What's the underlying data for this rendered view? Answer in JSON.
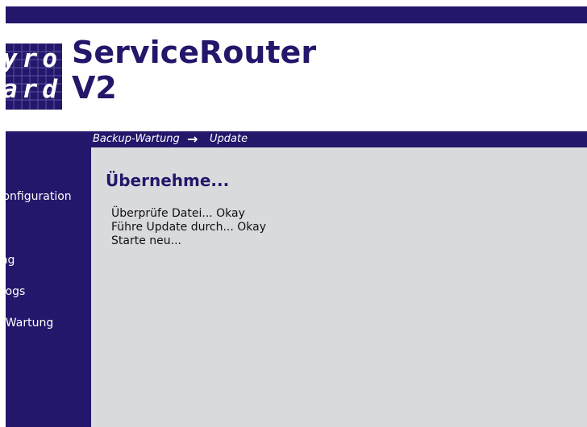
{
  "header": {
    "logo_line1": "yro",
    "logo_line2": "ard",
    "title_line1": "ServiceRouter",
    "title_line2": "V2"
  },
  "sidebar": {
    "items": [
      {
        "label": "Konfiguration"
      },
      {
        "label": "Wartung"
      },
      {
        "label": "Logs"
      },
      {
        "label": "Backup-Wartung"
      }
    ]
  },
  "breadcrumb": {
    "parent": "Backup-Wartung",
    "separator": "→",
    "current": "Update"
  },
  "main": {
    "heading": "Übernehme...",
    "log_lines": [
      "Überprüfe Datei... Okay",
      "Führe Update durch... Okay",
      "Starte neu..."
    ]
  },
  "colors": {
    "brand": "#22176b",
    "content_bg": "#d9dadc"
  }
}
